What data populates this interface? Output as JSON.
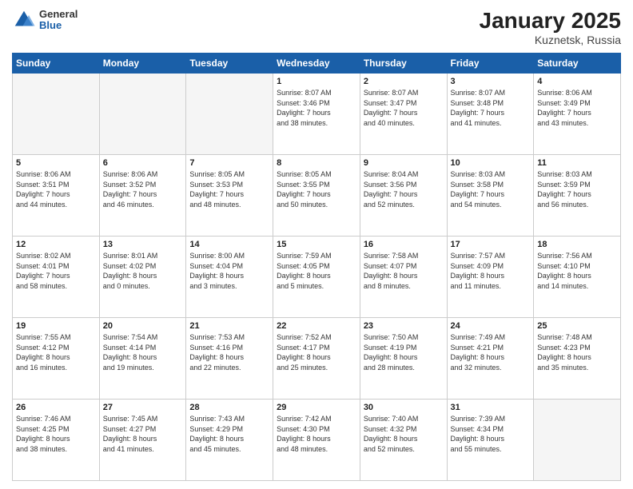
{
  "header": {
    "logo": {
      "general": "General",
      "blue": "Blue"
    },
    "title": "January 2025",
    "subtitle": "Kuznetsk, Russia"
  },
  "weekdays": [
    "Sunday",
    "Monday",
    "Tuesday",
    "Wednesday",
    "Thursday",
    "Friday",
    "Saturday"
  ],
  "weeks": [
    [
      {
        "day": "",
        "info": ""
      },
      {
        "day": "",
        "info": ""
      },
      {
        "day": "",
        "info": ""
      },
      {
        "day": "1",
        "info": "Sunrise: 8:07 AM\nSunset: 3:46 PM\nDaylight: 7 hours\nand 38 minutes."
      },
      {
        "day": "2",
        "info": "Sunrise: 8:07 AM\nSunset: 3:47 PM\nDaylight: 7 hours\nand 40 minutes."
      },
      {
        "day": "3",
        "info": "Sunrise: 8:07 AM\nSunset: 3:48 PM\nDaylight: 7 hours\nand 41 minutes."
      },
      {
        "day": "4",
        "info": "Sunrise: 8:06 AM\nSunset: 3:49 PM\nDaylight: 7 hours\nand 43 minutes."
      }
    ],
    [
      {
        "day": "5",
        "info": "Sunrise: 8:06 AM\nSunset: 3:51 PM\nDaylight: 7 hours\nand 44 minutes."
      },
      {
        "day": "6",
        "info": "Sunrise: 8:06 AM\nSunset: 3:52 PM\nDaylight: 7 hours\nand 46 minutes."
      },
      {
        "day": "7",
        "info": "Sunrise: 8:05 AM\nSunset: 3:53 PM\nDaylight: 7 hours\nand 48 minutes."
      },
      {
        "day": "8",
        "info": "Sunrise: 8:05 AM\nSunset: 3:55 PM\nDaylight: 7 hours\nand 50 minutes."
      },
      {
        "day": "9",
        "info": "Sunrise: 8:04 AM\nSunset: 3:56 PM\nDaylight: 7 hours\nand 52 minutes."
      },
      {
        "day": "10",
        "info": "Sunrise: 8:03 AM\nSunset: 3:58 PM\nDaylight: 7 hours\nand 54 minutes."
      },
      {
        "day": "11",
        "info": "Sunrise: 8:03 AM\nSunset: 3:59 PM\nDaylight: 7 hours\nand 56 minutes."
      }
    ],
    [
      {
        "day": "12",
        "info": "Sunrise: 8:02 AM\nSunset: 4:01 PM\nDaylight: 7 hours\nand 58 minutes."
      },
      {
        "day": "13",
        "info": "Sunrise: 8:01 AM\nSunset: 4:02 PM\nDaylight: 8 hours\nand 0 minutes."
      },
      {
        "day": "14",
        "info": "Sunrise: 8:00 AM\nSunset: 4:04 PM\nDaylight: 8 hours\nand 3 minutes."
      },
      {
        "day": "15",
        "info": "Sunrise: 7:59 AM\nSunset: 4:05 PM\nDaylight: 8 hours\nand 5 minutes."
      },
      {
        "day": "16",
        "info": "Sunrise: 7:58 AM\nSunset: 4:07 PM\nDaylight: 8 hours\nand 8 minutes."
      },
      {
        "day": "17",
        "info": "Sunrise: 7:57 AM\nSunset: 4:09 PM\nDaylight: 8 hours\nand 11 minutes."
      },
      {
        "day": "18",
        "info": "Sunrise: 7:56 AM\nSunset: 4:10 PM\nDaylight: 8 hours\nand 14 minutes."
      }
    ],
    [
      {
        "day": "19",
        "info": "Sunrise: 7:55 AM\nSunset: 4:12 PM\nDaylight: 8 hours\nand 16 minutes."
      },
      {
        "day": "20",
        "info": "Sunrise: 7:54 AM\nSunset: 4:14 PM\nDaylight: 8 hours\nand 19 minutes."
      },
      {
        "day": "21",
        "info": "Sunrise: 7:53 AM\nSunset: 4:16 PM\nDaylight: 8 hours\nand 22 minutes."
      },
      {
        "day": "22",
        "info": "Sunrise: 7:52 AM\nSunset: 4:17 PM\nDaylight: 8 hours\nand 25 minutes."
      },
      {
        "day": "23",
        "info": "Sunrise: 7:50 AM\nSunset: 4:19 PM\nDaylight: 8 hours\nand 28 minutes."
      },
      {
        "day": "24",
        "info": "Sunrise: 7:49 AM\nSunset: 4:21 PM\nDaylight: 8 hours\nand 32 minutes."
      },
      {
        "day": "25",
        "info": "Sunrise: 7:48 AM\nSunset: 4:23 PM\nDaylight: 8 hours\nand 35 minutes."
      }
    ],
    [
      {
        "day": "26",
        "info": "Sunrise: 7:46 AM\nSunset: 4:25 PM\nDaylight: 8 hours\nand 38 minutes."
      },
      {
        "day": "27",
        "info": "Sunrise: 7:45 AM\nSunset: 4:27 PM\nDaylight: 8 hours\nand 41 minutes."
      },
      {
        "day": "28",
        "info": "Sunrise: 7:43 AM\nSunset: 4:29 PM\nDaylight: 8 hours\nand 45 minutes."
      },
      {
        "day": "29",
        "info": "Sunrise: 7:42 AM\nSunset: 4:30 PM\nDaylight: 8 hours\nand 48 minutes."
      },
      {
        "day": "30",
        "info": "Sunrise: 7:40 AM\nSunset: 4:32 PM\nDaylight: 8 hours\nand 52 minutes."
      },
      {
        "day": "31",
        "info": "Sunrise: 7:39 AM\nSunset: 4:34 PM\nDaylight: 8 hours\nand 55 minutes."
      },
      {
        "day": "",
        "info": ""
      }
    ]
  ]
}
